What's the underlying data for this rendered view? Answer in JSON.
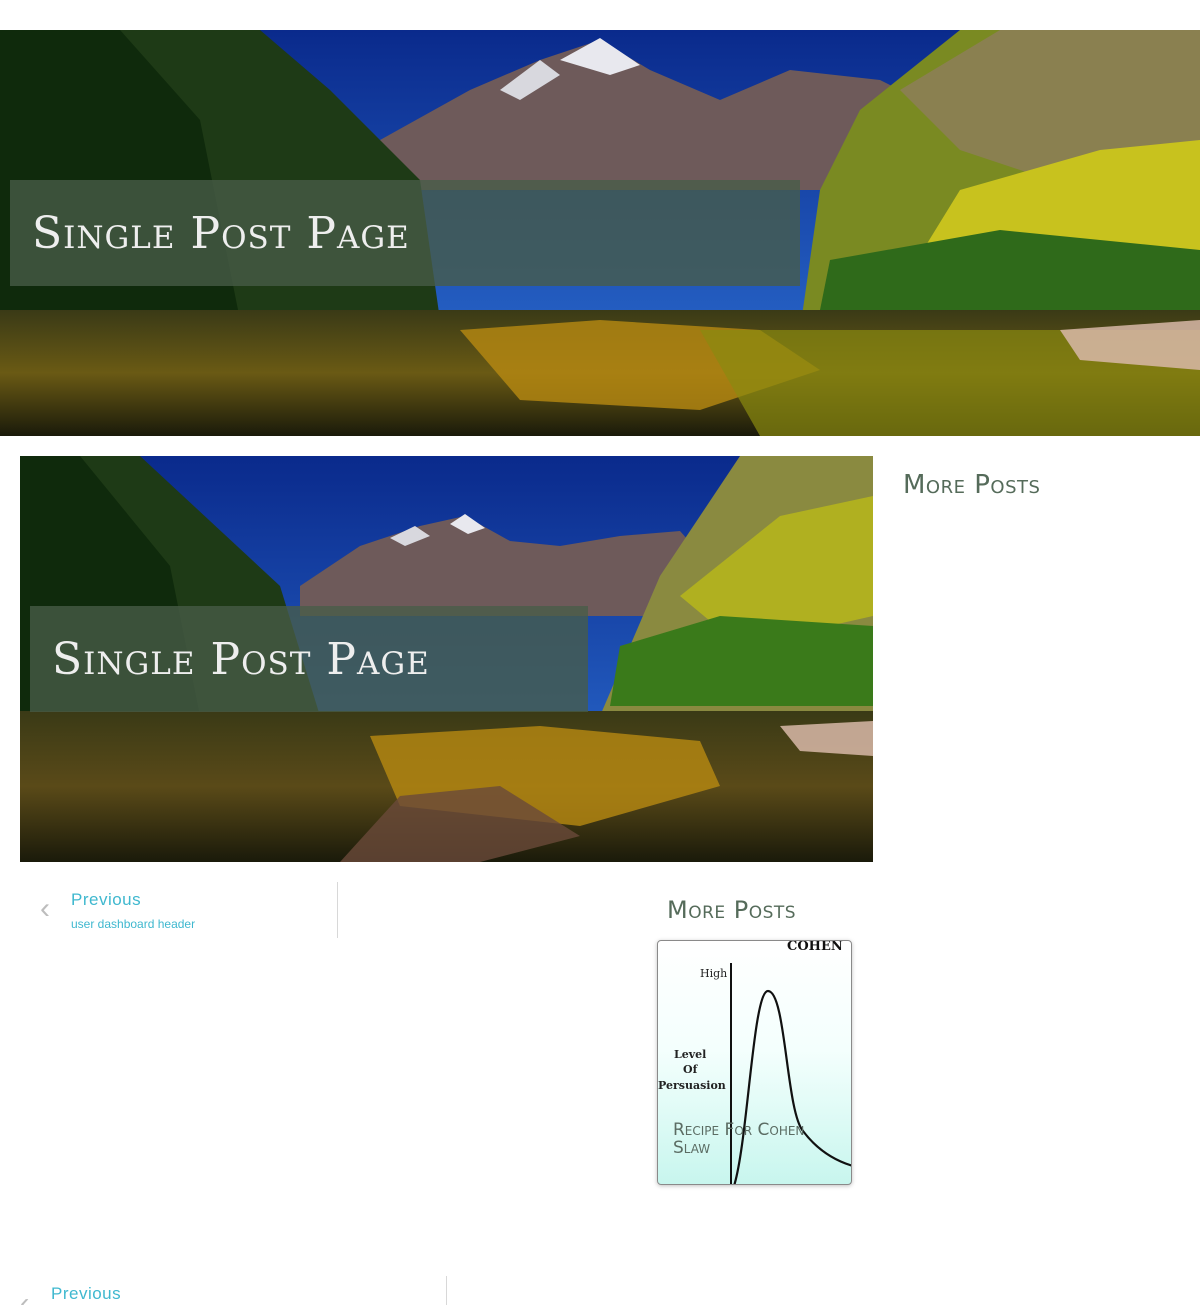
{
  "hero": {
    "title": "Single Post Page"
  },
  "post": {
    "image_title": "Single Post Page"
  },
  "sidebar": {
    "heading": "More Posts"
  },
  "post_navigation": {
    "chevron": "‹",
    "previous_label": "Previous",
    "previous_post_title": "user dashboard header"
  },
  "more_posts": {
    "heading": "More Posts",
    "cards": [
      {
        "title": "Recipe For Cohen Slaw",
        "graphic": {
          "brand": "COHEN",
          "y_high": "High",
          "y_label_1": "Level",
          "y_label_2": "Of",
          "y_label_3": "Persuasion"
        }
      }
    ]
  },
  "bottom_navigation": {
    "chevron": "‹",
    "previous_label": "Previous"
  },
  "colors": {
    "link": "#3fb8cf",
    "heading": "#556b5a",
    "title_band": "#485c48"
  }
}
